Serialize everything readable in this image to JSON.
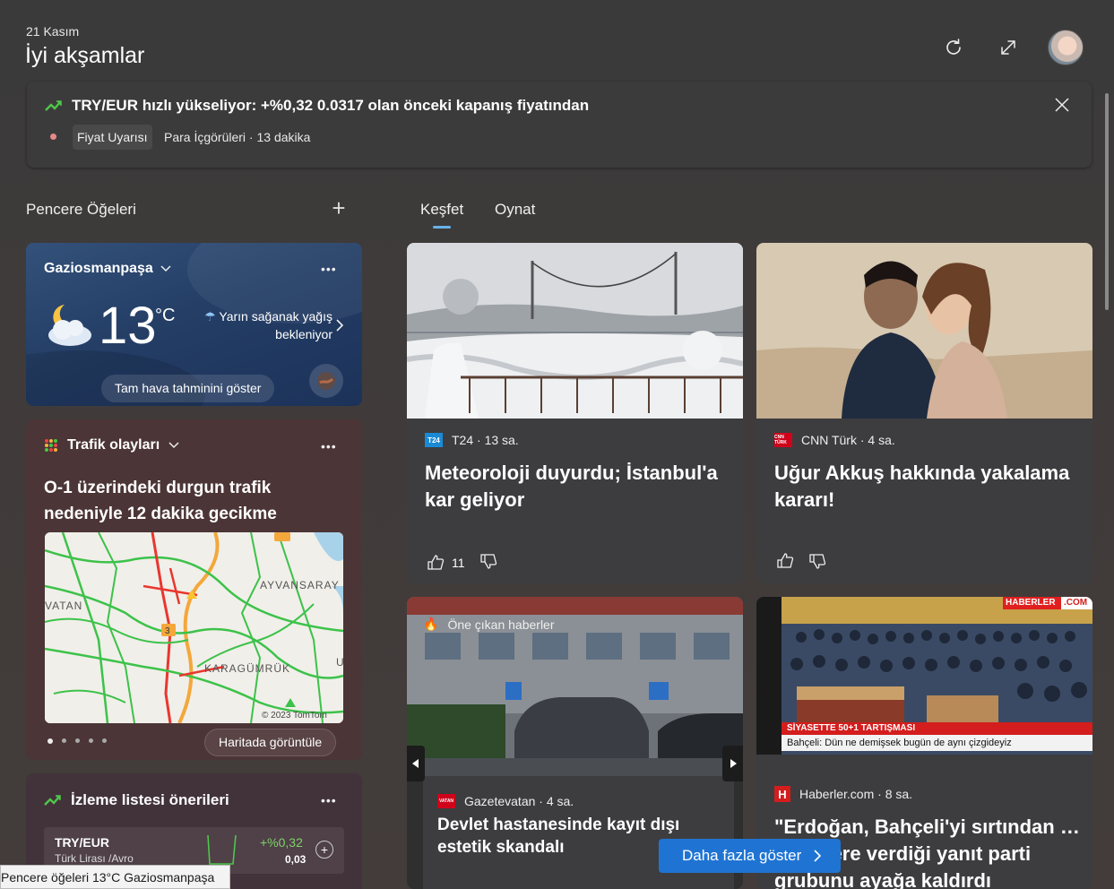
{
  "header": {
    "date": "21 Kasım",
    "greeting": "İyi akşamlar"
  },
  "alert": {
    "title": "TRY/EUR hızlı yükseliyor: +%0,32 0.0317 olan önceki kapanış fiyatından",
    "chip": "Fiyat Uyarısı",
    "meta": "Para İçgörüleri · 13 dakika"
  },
  "widgets": {
    "section_title": "Pencere Öğeleri",
    "add_label": "+",
    "weather": {
      "city": "Gaziosmanpaşa",
      "temp": "13",
      "unit": "°C",
      "forecast": "Yarın sağanak yağış bekleniyor",
      "button": "Tam hava tahminini göster"
    },
    "traffic": {
      "title": "Trafik olayları",
      "description": "O-1 üzerindeki durgun trafik nedeniyle 12 dakika gecikme",
      "map_labels": [
        "AYVANSARAY",
        "VATAN",
        "KARAGÜMRÜK",
        "U"
      ],
      "copyright": "© 2023 TomTom",
      "button": "Haritada görüntüle"
    },
    "watchlist": {
      "title": "İzleme listesi önerileri",
      "items": [
        {
          "symbol": "TRY/EUR",
          "name": "Türk Lirası /Avro",
          "change": "+%0,32",
          "value": "0,03"
        }
      ]
    }
  },
  "tabs": [
    "Keşfet",
    "Oynat"
  ],
  "news": [
    {
      "source": "T24",
      "logo": "T24",
      "time": "13 sa.",
      "source_line": "T24 · 13 sa.",
      "headline": "Meteoroloji duyurdu; İstanbul'a kar geliyor",
      "likes": "11"
    },
    {
      "source": "CNN Türk",
      "logo": "CNN TÜRK",
      "time": "4 sa.",
      "source_line": "CNN Türk · 4 sa.",
      "headline": "Uğur Akkuş hakkında yakalama kararı!",
      "likes": ""
    },
    {
      "badge": "Öne çıkan haberler",
      "source_line": "Gazetevatan · 4 sa.",
      "logo": "VATAN",
      "headline": "Devlet hastanesinde kayıt dışı estetik skandalı"
    },
    {
      "source_line": "Haberler.com · 8 sa.",
      "logo": "H",
      "headline": "\"Erdoğan, Bahçeli'yi sırtından … diyenlere verdiği yanıt parti grubunu ayağa kaldırdı",
      "tv_brand": "HABERLER",
      "tv_brand2": ".COM",
      "tv_tag": "SİYASETTE 50+1 TARTIŞMASI",
      "tv_caption": "Bahçeli: Dün ne demişsek bugün de aynı çizgideyiz"
    }
  ],
  "more_button": "Daha fazla göster",
  "tooltip": "Pencere öğeleri 13°C Gaziosmanpaşa",
  "colors": {
    "accent": "#1f74d3",
    "weather_bg": "#243e66",
    "traffic_bg": "#4c3536",
    "positive": "#7ed06a"
  }
}
